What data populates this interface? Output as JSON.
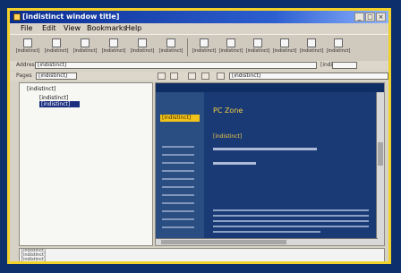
{
  "window": {
    "title": "[indistinct window title]"
  },
  "menu": [
    "File",
    "Edit",
    "View",
    "Bookmarks",
    "Help"
  ],
  "toolbar": {
    "buttons": [
      "[indistinct]",
      "[indistinct]",
      "[indistinct]",
      "[indistinct]",
      "[indistinct]",
      "[indistinct]",
      "[indistinct]",
      "[indistinct]",
      "[indistinct]",
      "[indistinct]",
      "[indistinct]",
      "[indistinct]"
    ]
  },
  "address_bar": {
    "label": "Address",
    "value": "[indistinct]",
    "zoom_label": "[indistinct]"
  },
  "pages_row": {
    "label": "Pages",
    "value": "[indistinct]",
    "url_value": "[indistinct]"
  },
  "tree": {
    "root": "[indistinct]",
    "child1": "[indistinct]",
    "child2": "[indistinct]"
  },
  "page": {
    "sidebar_highlight": "[indistinct]",
    "heading": "PC Zone",
    "subheading": "[indistinct]"
  },
  "log": {
    "lines": [
      "[indistinct]",
      "[indistinct]",
      "[indistinct]"
    ]
  },
  "colors": {
    "frame": "#f2d22a",
    "title": "#0a2d8f",
    "page_bg": "#1a3a75",
    "accent": "#f2ce43"
  }
}
